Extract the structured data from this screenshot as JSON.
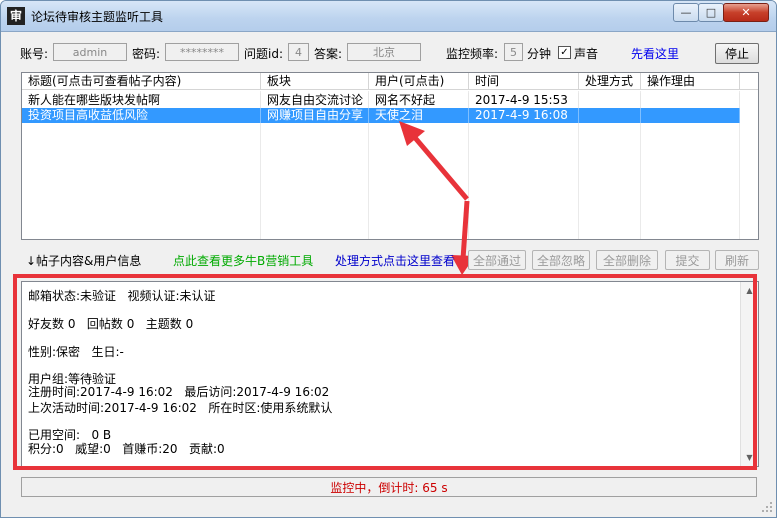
{
  "window": {
    "icon_glyph": "审",
    "title": "论坛待审核主题监听工具",
    "minimize_glyph": "—",
    "maximize_glyph": "□",
    "close_glyph": "✕"
  },
  "toolbar": {
    "account_label": "账号:",
    "account_value": "admin",
    "password_label": "密码:",
    "password_value": "********",
    "question_id_label": "问题id:",
    "question_id_value": "4",
    "answer_label": "答案:",
    "answer_value": "北京",
    "frequency_label": "监控频率:",
    "frequency_value": "5",
    "frequency_unit": "分钟",
    "sound_checked": true,
    "sound_label": "声音",
    "help_link": "先看这里",
    "stop_button": "停止"
  },
  "table": {
    "columns": [
      "标题(可点击可查看帖子内容)",
      "板块",
      "用户(可点击)",
      "时间",
      "处理方式",
      "操作理由"
    ],
    "rows": [
      {
        "title": "新人能在哪些版块发帖啊",
        "board": "网友自由交流讨论",
        "user": "网名不好起",
        "time": "2017-4-9 15:53",
        "action": "",
        "reason": "",
        "selected": false
      },
      {
        "title": "投资项目高收益低风险",
        "board": "网赚项目自由分享",
        "user": "天使之泪",
        "time": "2017-4-9 16:08",
        "action": "",
        "reason": "",
        "selected": true
      }
    ]
  },
  "actions": {
    "post_user_info": "↓帖子内容&用户信息",
    "more_tools_link": "点此查看更多牛B营销工具",
    "process_link": "处理方式点击这里查看",
    "pass_all": "全部通过",
    "ignore_all": "全部忽略",
    "delete_all": "全部删除",
    "submit": "提交",
    "refresh": "刷新"
  },
  "colors": {
    "selection": "#3399ff",
    "annotation_red": "#e8333a",
    "green_link": "#00aa00",
    "blue_link": "#0000cc",
    "status_red": "#cc0000"
  },
  "user_info": {
    "line1": "邮箱状态:未验证   视频认证:未认证",
    "line2": "好友数 0   回帖数 0   主题数 0",
    "line3": "性别:保密   生日:-",
    "line4": "用户组:等待验证",
    "line5": "注册时间:2017-4-9 16:02   最后访问:2017-4-9 16:02",
    "line6": "上次活动时间:2017-4-9 16:02   所在时区:使用系统默认",
    "line7": "已用空间:   0 B",
    "line8": "积分:0   威望:0   首赚币:20   贡献:0"
  },
  "status": {
    "text": "监控中，倒计时: 65 s"
  }
}
